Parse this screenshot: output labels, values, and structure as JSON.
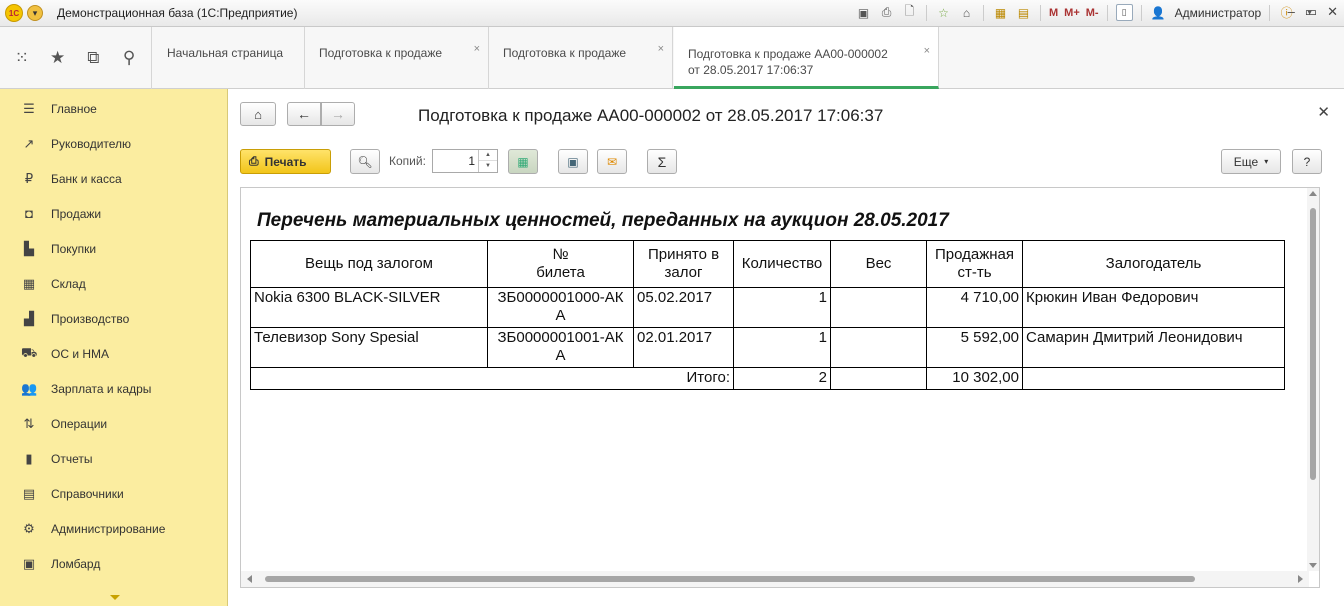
{
  "app": {
    "title": "Демонстрационная база  (1С:Предприятие)",
    "user": "Администратор",
    "m_labels": [
      "M",
      "M+",
      "M-"
    ]
  },
  "tabs": [
    {
      "label": "Начальная страница"
    },
    {
      "label": "Подготовка к продаже"
    },
    {
      "label": "Подготовка к продаже"
    },
    {
      "label_line1": "Подготовка к продаже АА00-000002",
      "label_line2": "от 28.05.2017 17:06:37"
    }
  ],
  "sidebar": {
    "items": [
      {
        "label": "Главное",
        "icon": "menu-icon"
      },
      {
        "label": "Руководителю",
        "icon": "chart-line-icon"
      },
      {
        "label": "Банк и касса",
        "icon": "ruble-icon"
      },
      {
        "label": "Продажи",
        "icon": "bag-icon"
      },
      {
        "label": "Покупки",
        "icon": "cart-icon"
      },
      {
        "label": "Склад",
        "icon": "warehouse-icon"
      },
      {
        "label": "Производство",
        "icon": "factory-icon"
      },
      {
        "label": "ОС и НМА",
        "icon": "truck-icon"
      },
      {
        "label": "Зарплата и кадры",
        "icon": "people-icon"
      },
      {
        "label": "Операции",
        "icon": "operations-icon"
      },
      {
        "label": "Отчеты",
        "icon": "bar-chart-icon"
      },
      {
        "label": "Справочники",
        "icon": "books-icon"
      },
      {
        "label": "Администрирование",
        "icon": "gear-icon"
      },
      {
        "label": "Ломбард",
        "icon": "pawnshop-icon"
      }
    ]
  },
  "document": {
    "title": "Подготовка к продаже АА00-000002 от 28.05.2017 17:06:37",
    "print_label": "Печать",
    "copies_label": "Копий:",
    "copies_value": "1",
    "more_label": "Еще",
    "help_label": "?"
  },
  "report": {
    "title": "Перечень материальных ценностей, переданных на аукцион 28.05.2017",
    "headers": {
      "item": "Вещь под залогом",
      "ticket_1": "№",
      "ticket_2": "билета",
      "accepted_1": "Принято в",
      "accepted_2": "залог",
      "qty": "Количество",
      "weight": "Вес",
      "price_1": "Продажная",
      "price_2": "ст-ть",
      "pledgor": "Залогодатель"
    },
    "rows": [
      {
        "item": "Nokia 6300 BLACK-SILVER",
        "ticket_1": "ЗБ0000001000-АК",
        "ticket_2": "А",
        "date": "05.02.2017",
        "qty": "1",
        "weight": "",
        "price": "4 710,00",
        "pledgor": "Крюкин Иван Федорович"
      },
      {
        "item": "Телевизор Sony Spesial",
        "ticket_1": "ЗБ0000001001-АК",
        "ticket_2": "А",
        "date": "02.01.2017",
        "qty": "1",
        "weight": "",
        "price": "5 592,00",
        "pledgor": "Самарин Дмитрий Леонидович"
      }
    ],
    "total": {
      "label": "Итого:",
      "qty": "2",
      "price": "10 302,00"
    }
  }
}
